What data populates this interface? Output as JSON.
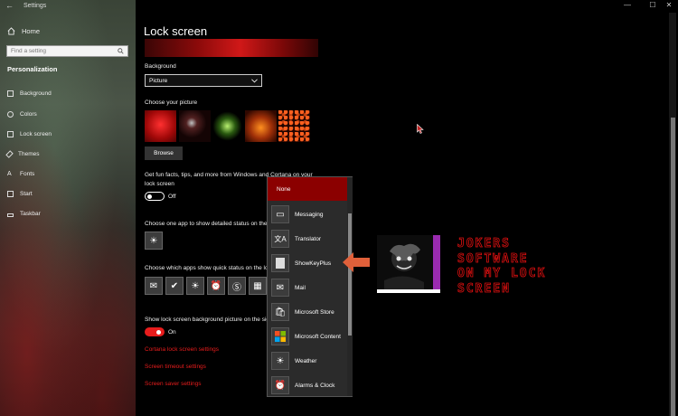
{
  "window": {
    "title": "Settings",
    "controls": [
      "—",
      "☐",
      "✕"
    ]
  },
  "sidebar": {
    "home": "Home",
    "search_placeholder": "Find a setting",
    "section": "Personalization",
    "items": [
      {
        "label": "Background",
        "icon": "image-icon"
      },
      {
        "label": "Colors",
        "icon": "palette-icon"
      },
      {
        "label": "Lock screen",
        "icon": "lock-screen-icon"
      },
      {
        "label": "Themes",
        "icon": "brush-icon"
      },
      {
        "label": "Fonts",
        "icon": "font-icon"
      },
      {
        "label": "Start",
        "icon": "start-icon"
      },
      {
        "label": "Taskbar",
        "icon": "taskbar-icon"
      }
    ]
  },
  "main": {
    "title": "Lock screen",
    "background_label": "Background",
    "background_value": "Picture",
    "choose_picture_label": "Choose your picture",
    "browse_label": "Browse",
    "fun_facts_line1": "Get fun facts, tips, and more from Windows and Cortana on your",
    "fun_facts_line2": "lock screen",
    "fun_facts_state": "Off",
    "detailed_status_label": "Choose one app to show detailed status on the lock screen",
    "quick_status_label": "Choose which apps show quick status on the lock screen",
    "show_bg_label": "Show lock screen background picture on the sign-in screen",
    "show_bg_state": "On",
    "links": [
      "Cortana lock screen settings",
      "Screen timeout settings",
      "Screen saver settings"
    ]
  },
  "flyout": {
    "none_label": "None",
    "items": [
      {
        "label": "Messaging",
        "icon": "message-icon"
      },
      {
        "label": "Translator",
        "icon": "translator-icon"
      },
      {
        "label": "ShowKeyPlus",
        "icon": "blank-app-icon"
      },
      {
        "label": "Mail",
        "icon": "mail-icon"
      },
      {
        "label": "Microsoft Store",
        "icon": "store-icon"
      },
      {
        "label": "Microsoft Content",
        "icon": "windows-logo-icon"
      },
      {
        "label": "Weather",
        "icon": "weather-icon"
      },
      {
        "label": "Alarms & Clock",
        "icon": "alarm-clock-icon"
      }
    ]
  },
  "annotation": {
    "lines": [
      "JOKERS",
      "SOFTWARE",
      "ON MY LOCK",
      "SCREEN"
    ],
    "accent": "#e01010"
  },
  "colors": {
    "accent_red": "#e81c1c",
    "selected_red": "#8b0000"
  }
}
